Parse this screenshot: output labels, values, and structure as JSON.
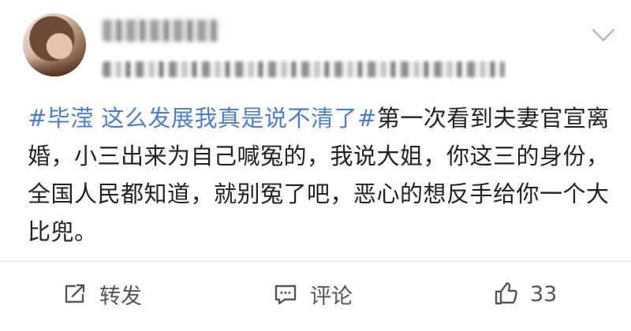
{
  "post": {
    "topic_text": "#毕滢 这么发展我真是说不清了#",
    "body_text": "第一次看到夫妻官宣离婚，小三出来为自己喊冤的，我说大姐，你这三的身份，全国人民都知道，就别冤了吧，恶心的想反手给你一个大比兜。"
  },
  "actions": {
    "repost_label": "转发",
    "comment_label": "评论",
    "like_count": "33"
  },
  "colors": {
    "topic": "#4c7ecb",
    "text": "#222222",
    "icon": "#555555",
    "divider": "#e9e9e9"
  },
  "icons": {
    "repost": "repost-icon",
    "comment": "comment-icon",
    "like": "like-icon",
    "menu": "chevron-down-icon"
  }
}
